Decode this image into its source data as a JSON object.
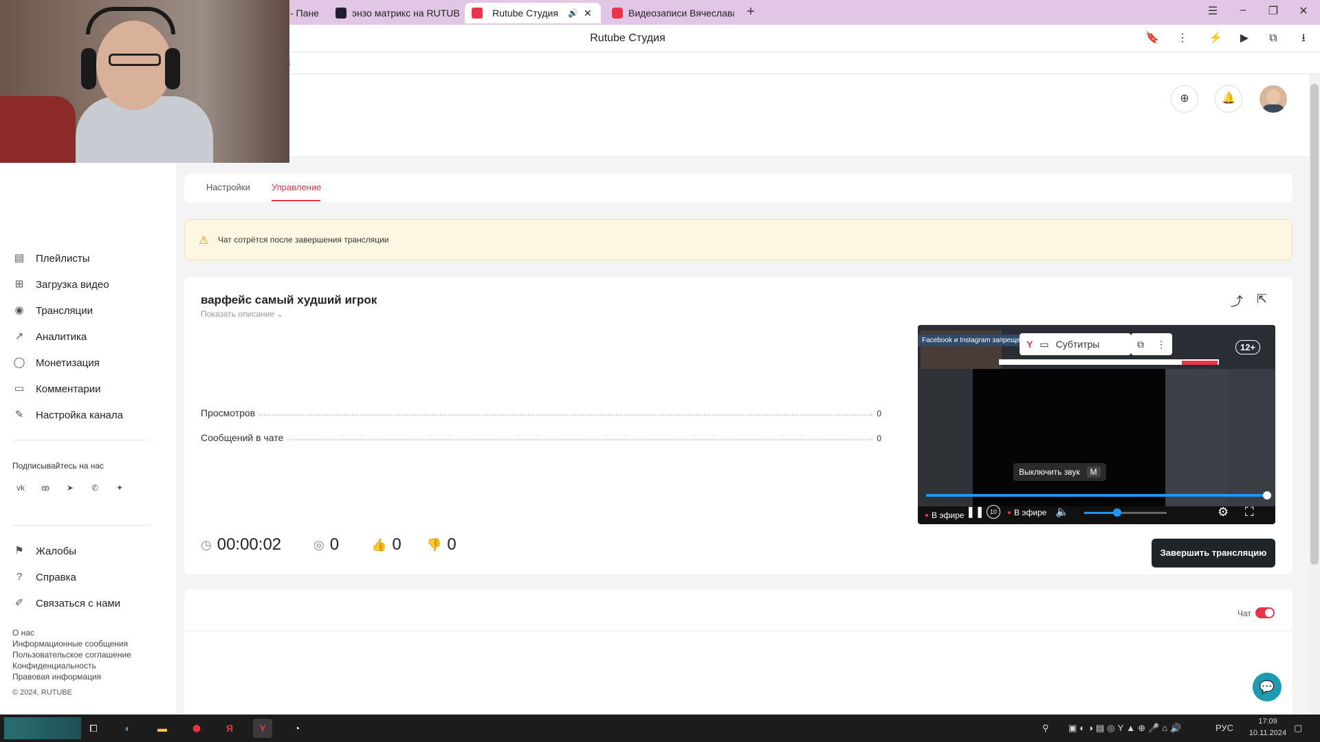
{
  "browser": {
    "tabs": [
      {
        "label": "- Пане",
        "icon": "dashboard-favicon"
      },
      {
        "label": "энзо матрикс на RUTUBE",
        "icon": "rutube-favicon"
      },
      {
        "label": "Rutube Студия",
        "icon": "rutube-studio-favicon"
      },
      {
        "label": "Видеозаписи Вячеслава",
        "icon": "video-favicon"
      }
    ],
    "new_tab": "+",
    "page_title": "Rutube Студия"
  },
  "sidebar": {
    "items": [
      {
        "label": "Плейлисты",
        "icon": "playlist-icon"
      },
      {
        "label": "Загрузка видео",
        "icon": "upload-icon"
      },
      {
        "label": "Трансляции",
        "icon": "broadcast-icon"
      },
      {
        "label": "Аналитика",
        "icon": "analytics-icon"
      },
      {
        "label": "Монетизация",
        "icon": "coin-icon"
      },
      {
        "label": "Комментарии",
        "icon": "comment-icon"
      },
      {
        "label": "Настройка канала",
        "icon": "wand-icon"
      }
    ],
    "subscribe_label": "Подписывайтесь на нас",
    "bottom_items": [
      {
        "label": "Жалобы",
        "icon": "flag-icon"
      },
      {
        "label": "Справка",
        "icon": "help-icon"
      },
      {
        "label": "Связаться с нами",
        "icon": "pencil-icon"
      }
    ],
    "footer_links": [
      "О нас",
      "Информационные сообщения",
      "Пользовательское соглашение",
      "Конфиденциальность",
      "Правовая информация"
    ],
    "copyright": "© 2024, RUTUBE"
  },
  "page_tabs": {
    "settings": "Настройки",
    "manage": "Управление"
  },
  "warning": "Чат сотрётся после завершения трансляции",
  "stream": {
    "title": "варфейс самый худший игрок",
    "show_description": "Показать описание",
    "stats": [
      {
        "label": "Просмотров",
        "value": "0"
      },
      {
        "label": "Сообщений в чате",
        "value": "0"
      }
    ],
    "duration": "00:00:02",
    "viewers": "0",
    "likes": "0",
    "dislikes": "0",
    "end_button": "Завершить трансляцию"
  },
  "player": {
    "banner": "Facebook и Instagram запрещен",
    "subtitles": "Субтитры",
    "age": "12+",
    "tooltip": "Выключить звук",
    "tooltip_key": "M",
    "live_label": "В эфире",
    "live_label2": "В эфире",
    "rewind": "10",
    "progress": 1.0,
    "volume": 0.4
  },
  "chat": {
    "label": "Чат",
    "enabled": true
  },
  "taskbar": {
    "lang": "РУС",
    "time": "17:09",
    "date": "10.11.2024"
  },
  "colors": {
    "accent": "#e8334a",
    "dark_button": "#1f2429",
    "player_blue": "#2196f3"
  }
}
